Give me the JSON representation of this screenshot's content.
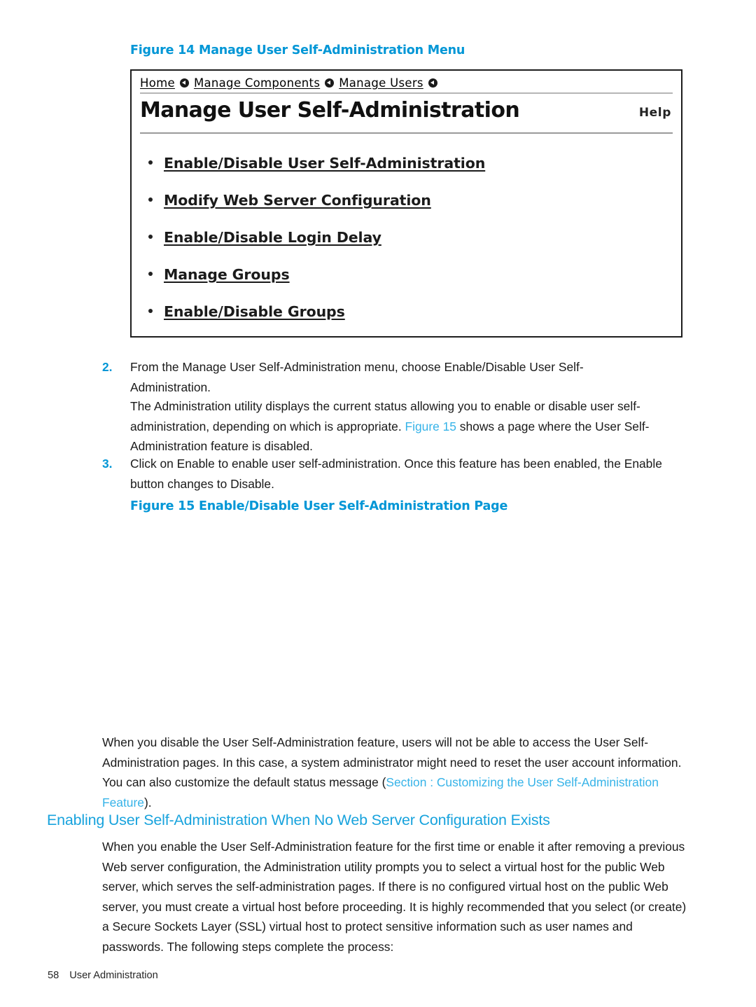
{
  "colors": {
    "caption_blue": "#0096D6",
    "section_heading_blue": "#18A3DD",
    "xref_link_blue": "#36B3E8",
    "body_text": "#1A1A1A"
  },
  "figure14": {
    "caption": "Figure 14 Manage User Self-Administration Menu",
    "screenshot": {
      "breadcrumb": [
        {
          "label": "Home"
        },
        {
          "label": "Manage Components"
        },
        {
          "label": "Manage Users"
        }
      ],
      "title": "Manage User Self-Administration",
      "help_label": "Help",
      "menu_items": [
        "Enable/Disable User Self-Administration",
        "Modify Web Server Configuration",
        "Enable/Disable Login Delay",
        "Manage Groups",
        "Enable/Disable Groups"
      ]
    }
  },
  "steps": [
    {
      "number": "2.",
      "text": "From the Manage User Self-Administration menu, choose Enable/Disable User Self-Administration."
    },
    {
      "number": "3.",
      "text": "Click on Enable to enable user self-administration. Once this feature has been enabled, the Enable button changes to Disable."
    }
  ],
  "paragraph_status": {
    "part1": "The Administration utility displays the current status allowing you to enable or disable user self-administration, depending on which is appropriate. ",
    "link": "Figure 15",
    "part2": " shows a page where the User Self-Administration feature is disabled."
  },
  "figure15": {
    "caption": "Figure 15 Enable/Disable User Self-Administration Page"
  },
  "paragraph_disable": {
    "part1": "When you disable the User Self-Administration feature, users will not be able to access the User Self-Administration pages. In this case, a system administrator might need to reset the user account information. You can also customize the default status message (",
    "link": "Section : Customizing the User Self-Administration Feature",
    "part2": ")."
  },
  "section": {
    "heading": "Enabling User Self-Administration When No Web Server Configuration Exists",
    "paragraph": "When you enable the User Self-Administration feature for the first time or enable it after removing a previous Web server configuration, the Administration utility prompts you to select a virtual host for the public Web server, which serves the self-administration pages. If there is no configured virtual host on the public Web server, you must create a virtual host before proceeding. It is highly recommended that you select (or create) a Secure Sockets Layer (SSL) virtual host to protect sensitive information such as user names and passwords. The following steps complete the process:"
  },
  "footer": {
    "page_number": "58",
    "chapter": "User Administration"
  }
}
